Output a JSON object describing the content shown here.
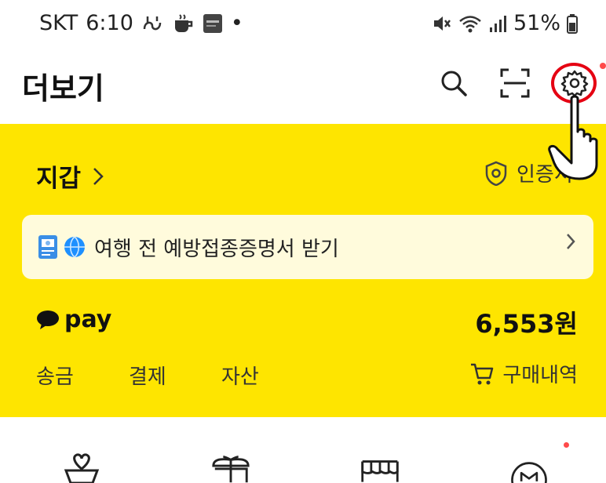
{
  "status_bar": {
    "carrier": "SKT",
    "time": "6:10",
    "dot": "•",
    "battery": "51%"
  },
  "header": {
    "title": "더보기"
  },
  "wallet": {
    "title": "지갑",
    "cert_label": "인증서",
    "vaccine_banner": "여행 전 예방접종증명서 받기",
    "pay_label": "pay",
    "balance": "6,553원",
    "actions": [
      "송금",
      "결제",
      "자산"
    ],
    "history_label": "구매내역"
  },
  "colors": {
    "brand_yellow": "#fee500",
    "highlight_red": "#e50012"
  }
}
